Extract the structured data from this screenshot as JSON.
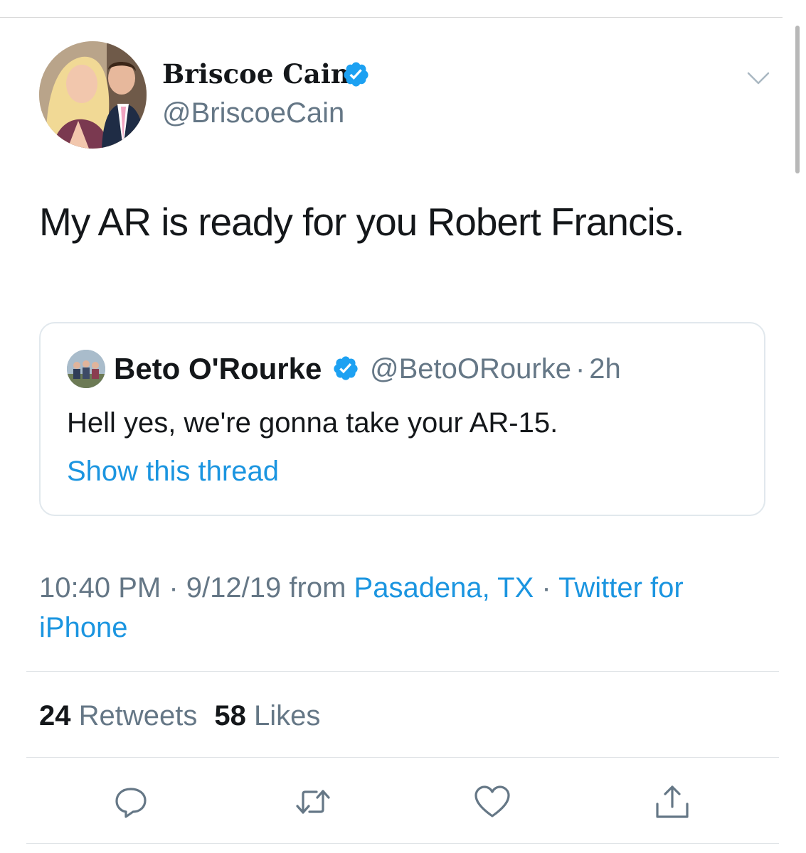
{
  "author": {
    "name": "Briscoe Cain",
    "handle": "@BriscoeCain"
  },
  "tweet": {
    "text": "My AR is ready for you Robert Francis."
  },
  "quoted_tweet": {
    "name": "Beto O'Rourke",
    "handle": "@BetoORourke",
    "separator": "·",
    "time": "2h",
    "text": "Hell yes, we're gonna take your AR-15.",
    "link": "Show this thread"
  },
  "meta": {
    "time": "10:40 PM",
    "separator": "·",
    "date": "9/12/19",
    "from_label": "from",
    "location": "Pasadena, TX",
    "source": "Twitter for iPhone"
  },
  "stats": {
    "retweets_count": "24",
    "retweets_label": "Retweets",
    "likes_count": "58",
    "likes_label": "Likes"
  },
  "actions": {
    "icons": [
      "reply-icon",
      "retweet-icon",
      "like-icon",
      "share-icon"
    ]
  },
  "colors": {
    "link_blue": "#1b95e0",
    "verified_blue": "#1da1f2",
    "secondary_text": "#657786",
    "primary_text": "#14171a"
  }
}
